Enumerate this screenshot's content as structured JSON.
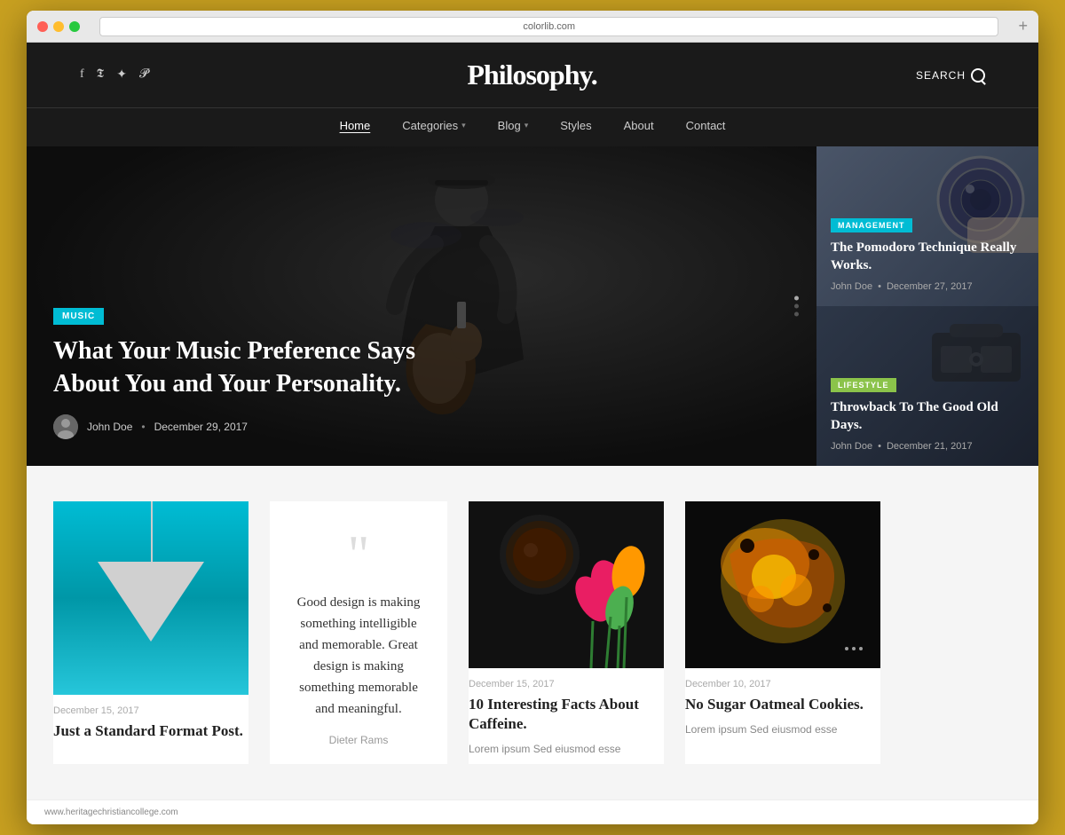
{
  "browser": {
    "url": "colorlib.com",
    "plus_label": "+"
  },
  "header": {
    "logo": "Philosophy.",
    "search_label": "SEARCH",
    "social_icons": [
      "f",
      "𝕿",
      "𝓘",
      "𝓟"
    ]
  },
  "nav": {
    "items": [
      {
        "label": "Home",
        "active": true,
        "has_dropdown": false
      },
      {
        "label": "Categories",
        "active": false,
        "has_dropdown": true
      },
      {
        "label": "Blog",
        "active": false,
        "has_dropdown": true
      },
      {
        "label": "Styles",
        "active": false,
        "has_dropdown": false
      },
      {
        "label": "About",
        "active": false,
        "has_dropdown": false
      },
      {
        "label": "Contact",
        "active": false,
        "has_dropdown": false
      }
    ]
  },
  "hero": {
    "category_badge": "MUSIC",
    "title": "What Your Music Preference Says About You and Your Personality.",
    "author": "John Doe",
    "date": "December 29, 2017"
  },
  "sidebar_cards": [
    {
      "tag": "MANAGEMENT",
      "tag_class": "tag-management",
      "title": "The Pomodoro Technique Really Works.",
      "author": "John Doe",
      "date": "December 27, 2017"
    },
    {
      "tag": "LIFESTYLE",
      "tag_class": "tag-lifestyle",
      "title": "Throwback To The Good Old Days.",
      "author": "John Doe",
      "date": "December 21, 2017"
    }
  ],
  "blog_posts": [
    {
      "type": "lamp",
      "date": "December 15, 2017",
      "title": "Just a Standard Format Post.",
      "excerpt": ""
    },
    {
      "type": "quote",
      "quote_text": "Good design is making something intelligible and memorable. Great design is making something memorable and meaningful.",
      "quote_author": "Dieter Rams",
      "date": "",
      "title": ""
    },
    {
      "type": "coffee",
      "date": "December 15, 2017",
      "title": "10 Interesting Facts About Caffeine.",
      "excerpt": "Lorem ipsum Sed eiusmod esse"
    },
    {
      "type": "food",
      "date": "December 10, 2017",
      "title": "No Sugar Oatmeal Cookies.",
      "excerpt": "Lorem ipsum Sed eiusmod esse"
    }
  ],
  "footer": {
    "url": "www.heritagechristiancollege.com"
  }
}
